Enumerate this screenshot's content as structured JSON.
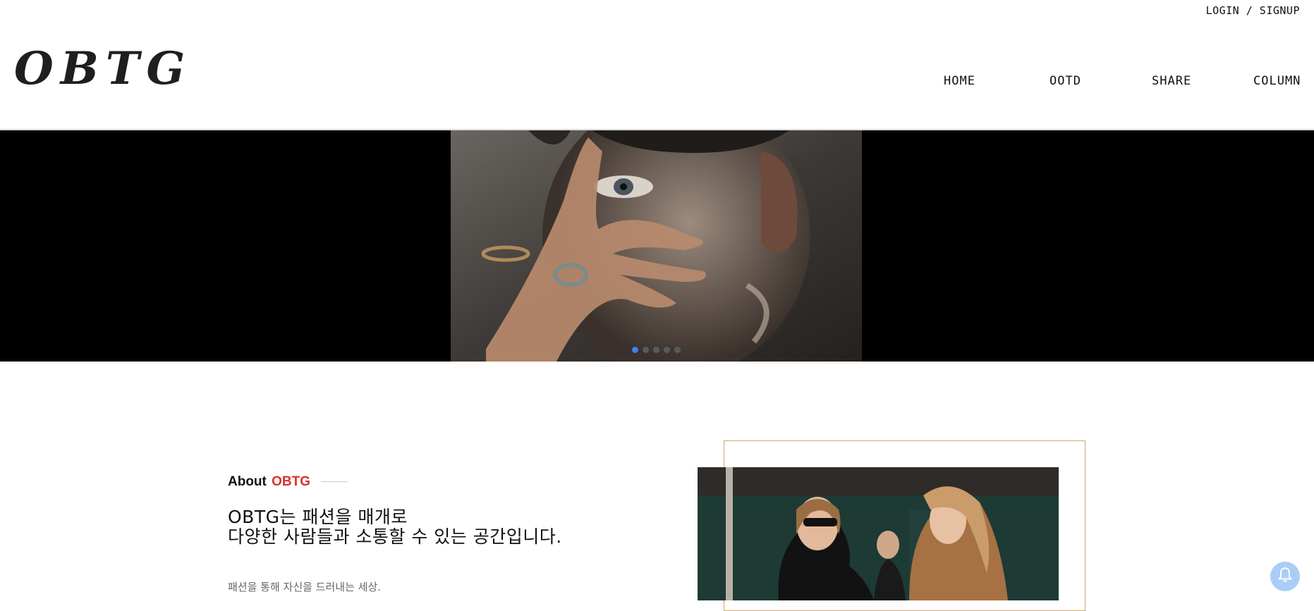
{
  "header": {
    "auth_link": "LOGIN / SIGNUP",
    "logo": "OBTG",
    "nav": [
      "HOME",
      "OOTD",
      "SHARE",
      "COLUMN"
    ]
  },
  "hero": {
    "slide_count": 5,
    "active_slide": 1,
    "active_dot_color": "#3b82f6"
  },
  "about": {
    "heading_prefix": "About",
    "heading_brand": "OBTG",
    "line1": "OBTG는 패션을 매개로",
    "line2": "다양한 사람들과 소통할 수 있는 공간입니다.",
    "description": "패션을 통해 자신을 드러내는 세상."
  },
  "colors": {
    "brand_red": "#d8322a",
    "frame_gold": "#c9a677",
    "bell_blue": "#a9cdf6"
  },
  "icons": {
    "notification": "bell-icon"
  }
}
